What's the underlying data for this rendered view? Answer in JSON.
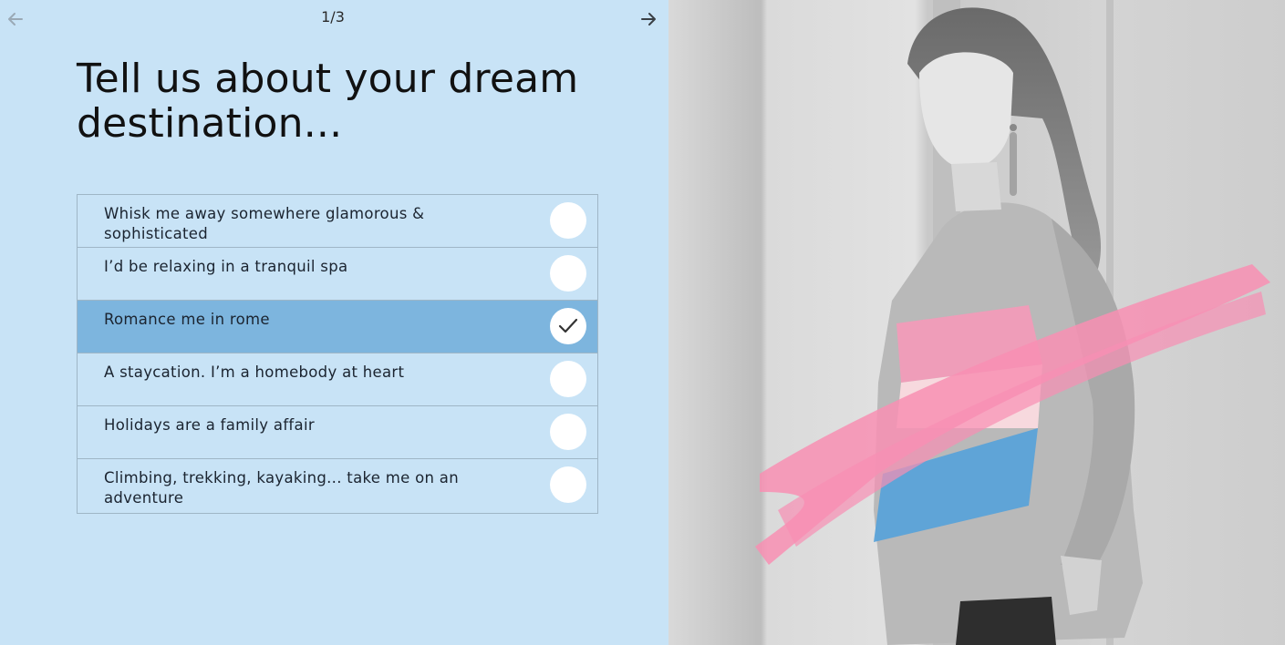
{
  "nav": {
    "prev_icon": "arrow-left-icon",
    "next_icon": "arrow-right-icon",
    "pager": "1/3"
  },
  "quiz": {
    "title": "Tell us about your dream destination...",
    "options": [
      {
        "label": "Whisk me away somewhere glamorous & sophisticated",
        "selected": false
      },
      {
        "label": "I’d be relaxing in a tranquil spa",
        "selected": false
      },
      {
        "label": "Romance me in rome",
        "selected": true
      },
      {
        "label": "A staycation. I’m a homebody at heart",
        "selected": false
      },
      {
        "label": "Holidays are a family affair",
        "selected": false
      },
      {
        "label": "Climbing, trekking, kayaking... take me on an adventure",
        "selected": false
      }
    ]
  },
  "colors": {
    "panel_bg": "#c8e3f6",
    "selected_row": "#7db5de",
    "brush_pink": "#f88fb3",
    "stripe_blue": "#5aa2d8"
  }
}
